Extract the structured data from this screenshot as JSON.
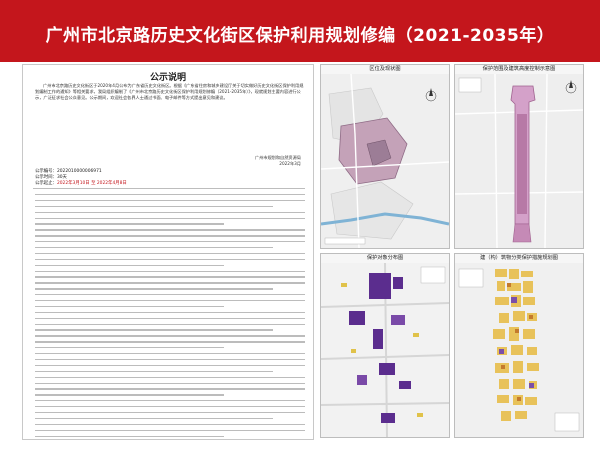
{
  "title": "广州市北京路历史文化街区保护利用规划修编（2021-2035年）",
  "notice": {
    "heading": "公示说明",
    "body": "广州市北京路历史文化街区于2020年4月公布为广东省历史文化街区。根据《广东省住房和城乡建设厅关于切实做好历史文化街区保护利用规划编制工作的通知》等相关要求，我局组织编制了《广州市北京路历史文化街区保护利用规划修编（2021-2035年）》，现就规划主要内容进行公示，广泛征求社会公众意见。公示期间，欢迎社会各界人士通过书面、电子邮件等方式提出意见和建议。",
    "sign": "广州市规划和自然资源局",
    "sign_date": "2022年3月",
    "code_label": "公示编号：",
    "code": "2022010000006971",
    "period_label": "公示时间：",
    "period": "30天",
    "date_label": "公示起止：",
    "date_range": "2022年3月10日 至 2022年4月8日"
  },
  "panels": [
    {
      "title": "区位及现状图"
    },
    {
      "title": "保护范围及建筑高度控制示意图"
    },
    {
      "title": "保护对象分布图"
    },
    {
      "title": "建（构）筑物分类保护措施规划图"
    }
  ],
  "colors": {
    "brand_red": "#c4161c",
    "protect_purple": "#5b2d8e",
    "zone_pink": "#d4a1c9",
    "tone_yellow": "#e0c24a"
  }
}
